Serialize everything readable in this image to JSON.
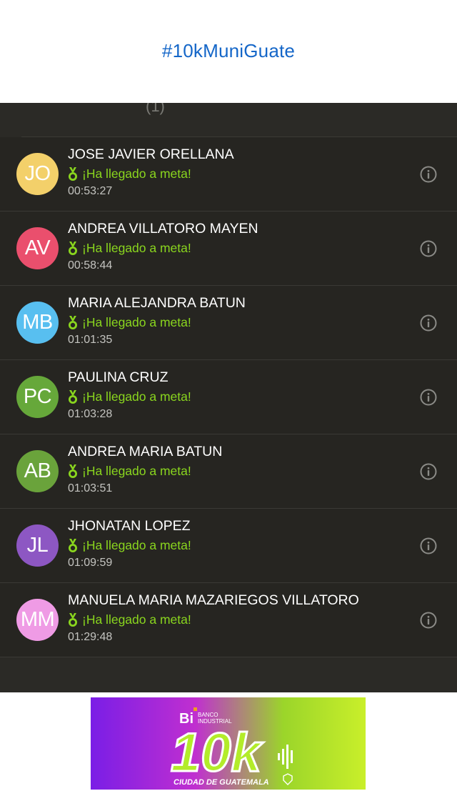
{
  "header": {
    "hashtag": "#10kMuniGuate"
  },
  "panel": {
    "truncated_text": "(1)"
  },
  "status_text": "¡Ha llegado a meta!",
  "runners": [
    {
      "initials": "JO",
      "name": "JOSE JAVIER ORELLANA",
      "time": "00:53:27",
      "color": "#f3d06a"
    },
    {
      "initials": "AV",
      "name": "ANDREA VILLATORO MAYEN",
      "time": "00:58:44",
      "color": "#ea4f6d"
    },
    {
      "initials": "MB",
      "name": "MARIA ALEJANDRA BATUN",
      "time": "01:01:35",
      "color": "#58bff0"
    },
    {
      "initials": "PC",
      "name": "PAULINA CRUZ",
      "time": "01:03:28",
      "color": "#66a83a"
    },
    {
      "initials": "AB",
      "name": "ANDREA MARIA BATUN",
      "time": "01:03:51",
      "color": "#6aa33b"
    },
    {
      "initials": "JL",
      "name": "JHONATAN LOPEZ",
      "time": "01:09:59",
      "color": "#8d57c3"
    },
    {
      "initials": "MM",
      "name": "MANUELA MARIA MAZARIEGOS VILLATORO",
      "time": "01:29:48",
      "color": "#ef9be5"
    }
  ],
  "banner": {
    "brand": "Bi",
    "bank_line1": "BANCO",
    "bank_line2": "INDUSTRIAL",
    "big_text": "10k",
    "city": "CIUDAD DE GUATEMALA"
  },
  "colors": {
    "link": "#1466c8",
    "status_green": "#8ad61e",
    "panel_bg": "#262521",
    "icon_gray": "#8b8b87"
  },
  "icons": {
    "status": "medal-icon",
    "info": "info-icon",
    "banner_seal": "shield-seal-icon"
  }
}
